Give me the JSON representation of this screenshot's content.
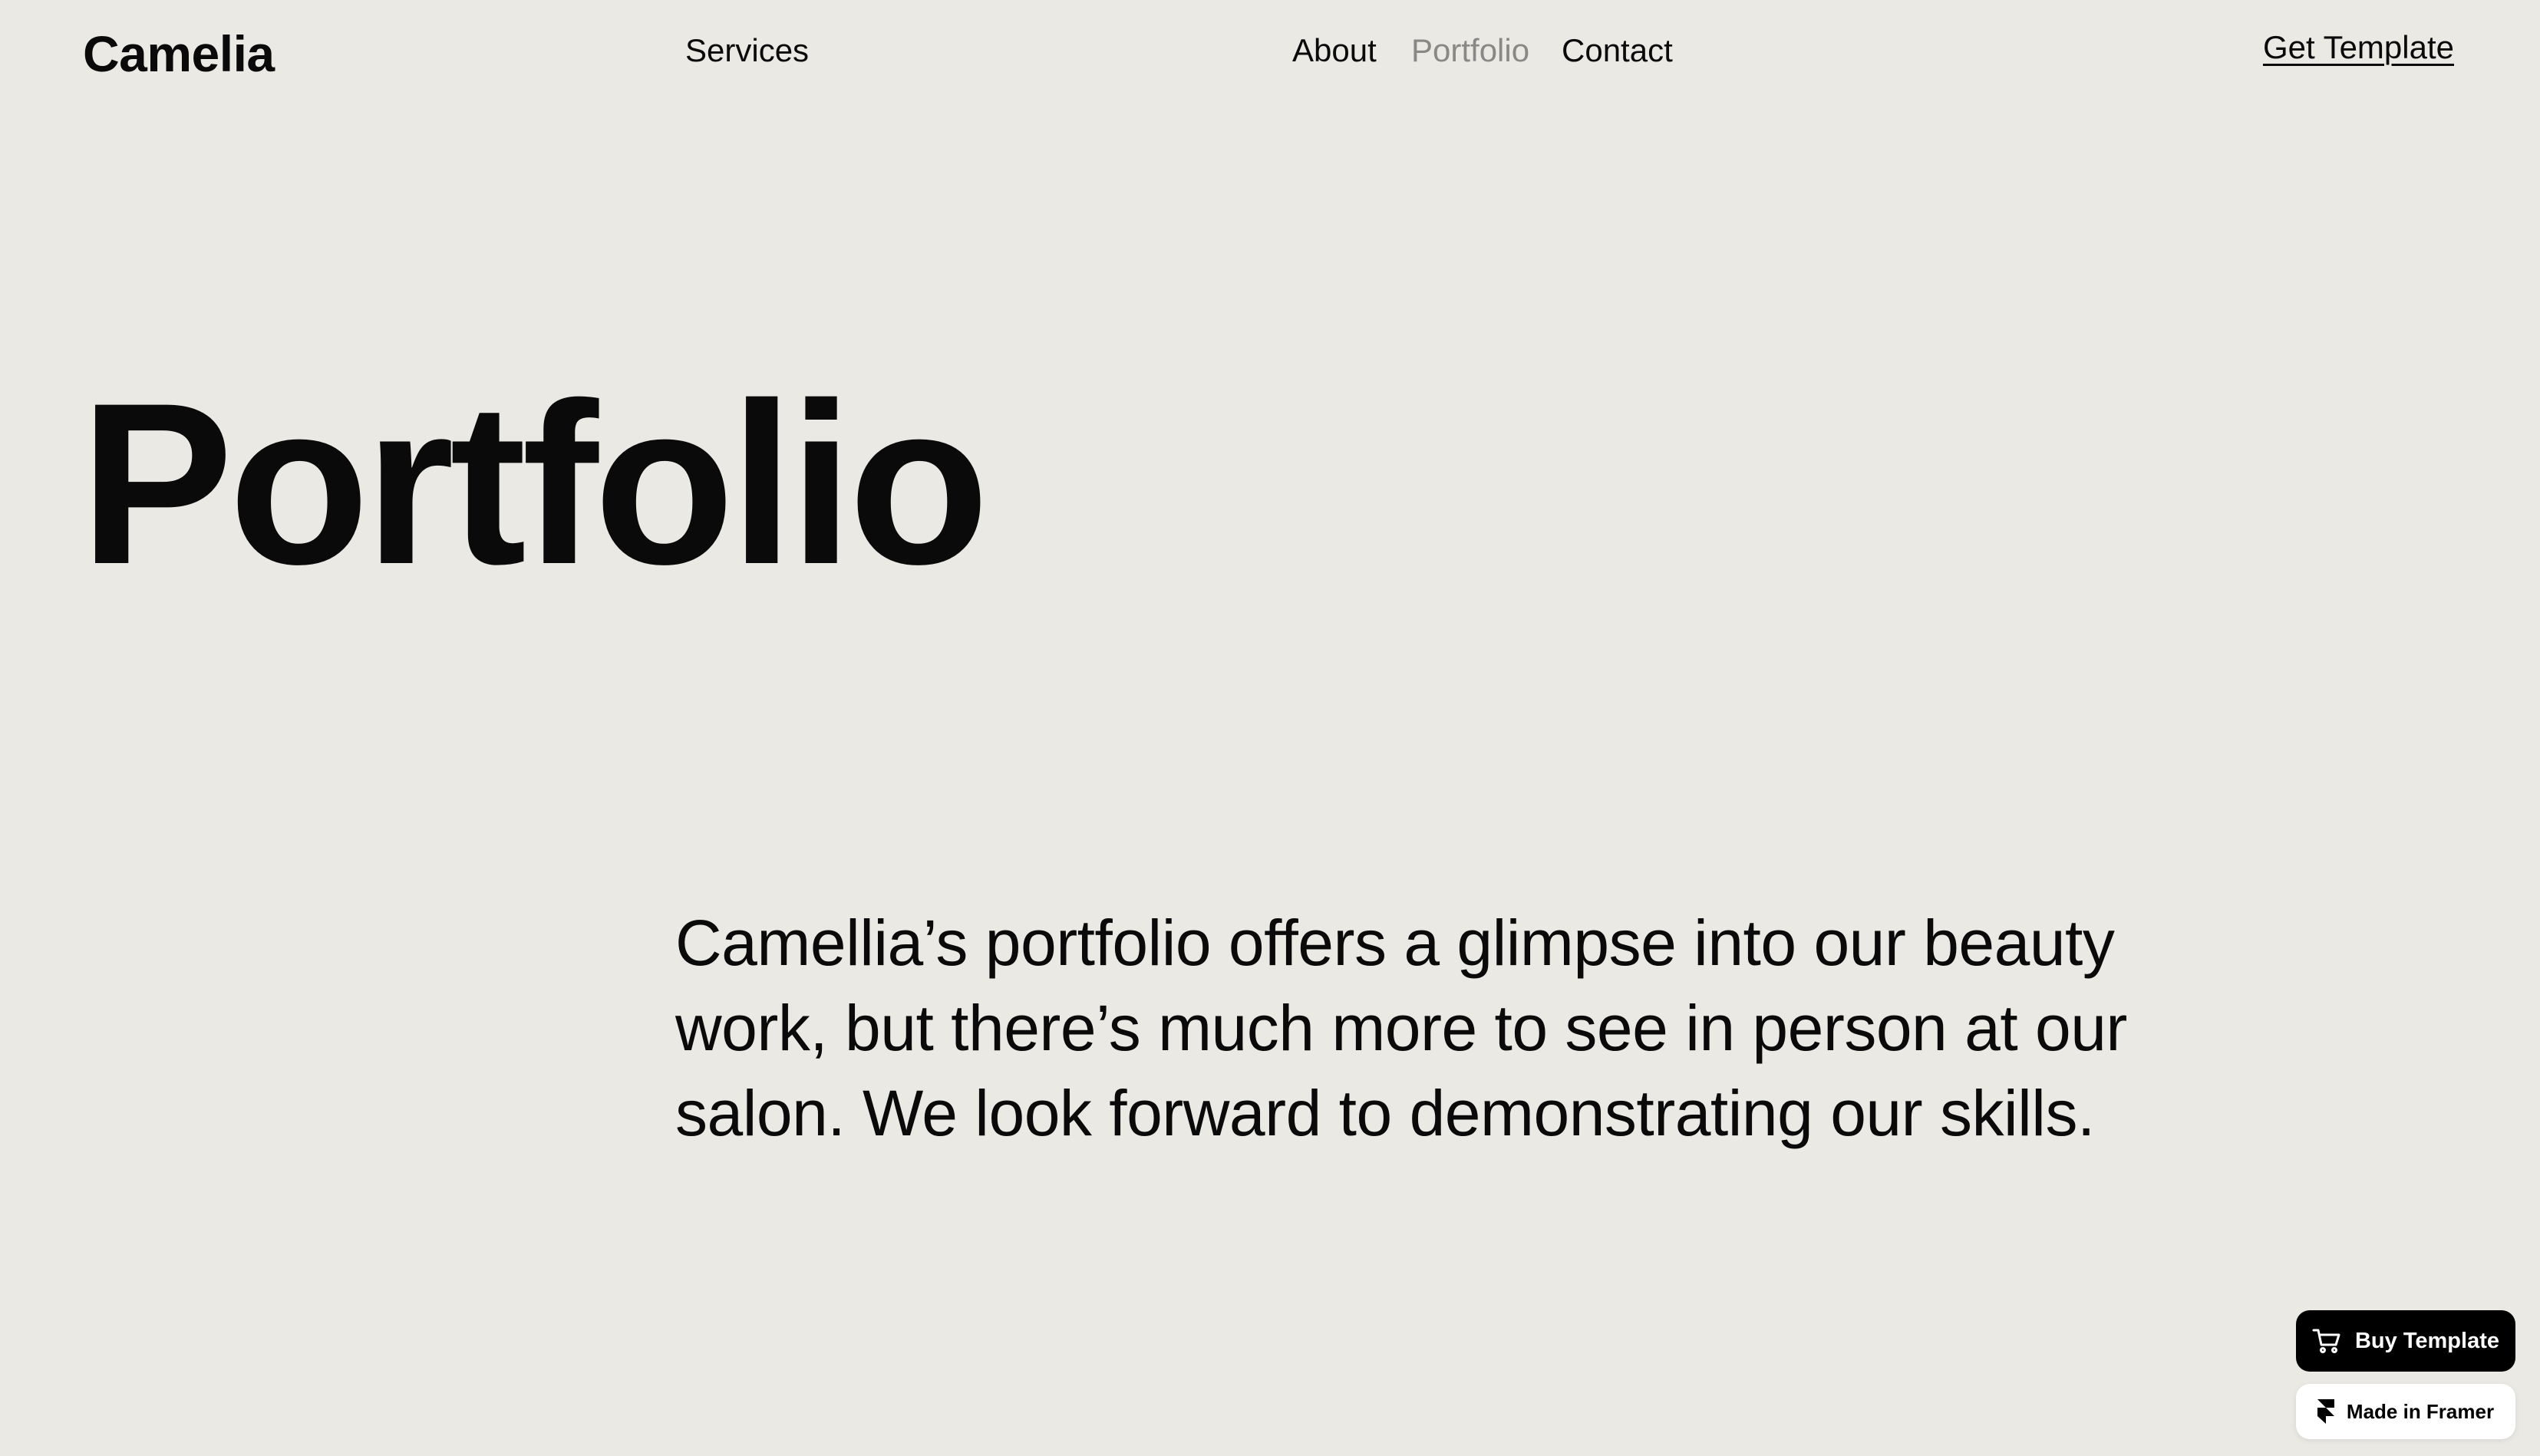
{
  "header": {
    "brand": "Camelia",
    "nav": {
      "services": "Services",
      "about": "About",
      "portfolio": "Portfolio",
      "contact": "Contact"
    },
    "cta": "Get Template",
    "active_item": "Portfolio"
  },
  "hero": {
    "title": "Portfolio",
    "intro": "Camellia’s portfolio offers a glimpse into our beauty work, but there’s much more to see in person at our salon. We look forward to demonstrating our skills."
  },
  "badges": {
    "buy_label": "Buy Template",
    "buy_icon": "cart-icon",
    "framer_label": "Made in Framer",
    "framer_icon": "framer-logo-icon"
  },
  "colors": {
    "background": "#ebe9e4",
    "text": "#0a0a0a",
    "active_nav": "#8a8887"
  }
}
